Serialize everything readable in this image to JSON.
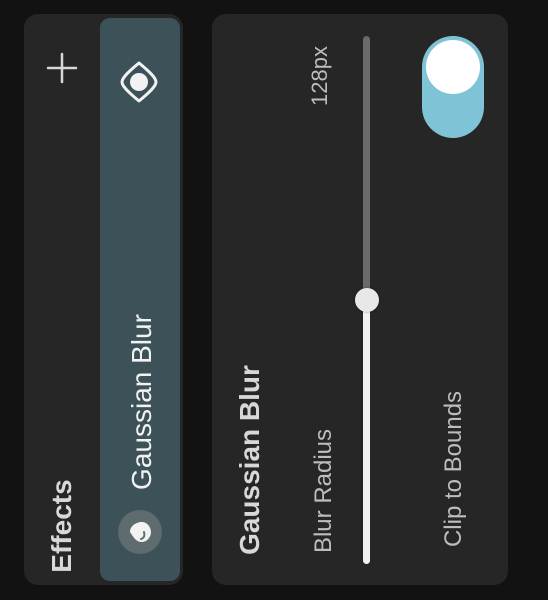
{
  "effects_panel": {
    "title": "Effects",
    "add_icon": "plus-icon",
    "items": [
      {
        "label": "Gaussian Blur",
        "visibility_icon": "eye-icon",
        "type_icon": "drop-icon",
        "selected": true
      }
    ]
  },
  "settings_panel": {
    "title": "Gaussian Blur",
    "blur_radius": {
      "label": "Blur Radius",
      "value_text": "128px",
      "level": 0.5
    },
    "clip_to_bounds": {
      "label": "Clip to Bounds",
      "on": true
    }
  },
  "colors": {
    "background": "#121212",
    "panel": "#262626",
    "selected_item": "#3c5158",
    "accent": "#7fc3d6",
    "text": "#d8d8d8"
  }
}
